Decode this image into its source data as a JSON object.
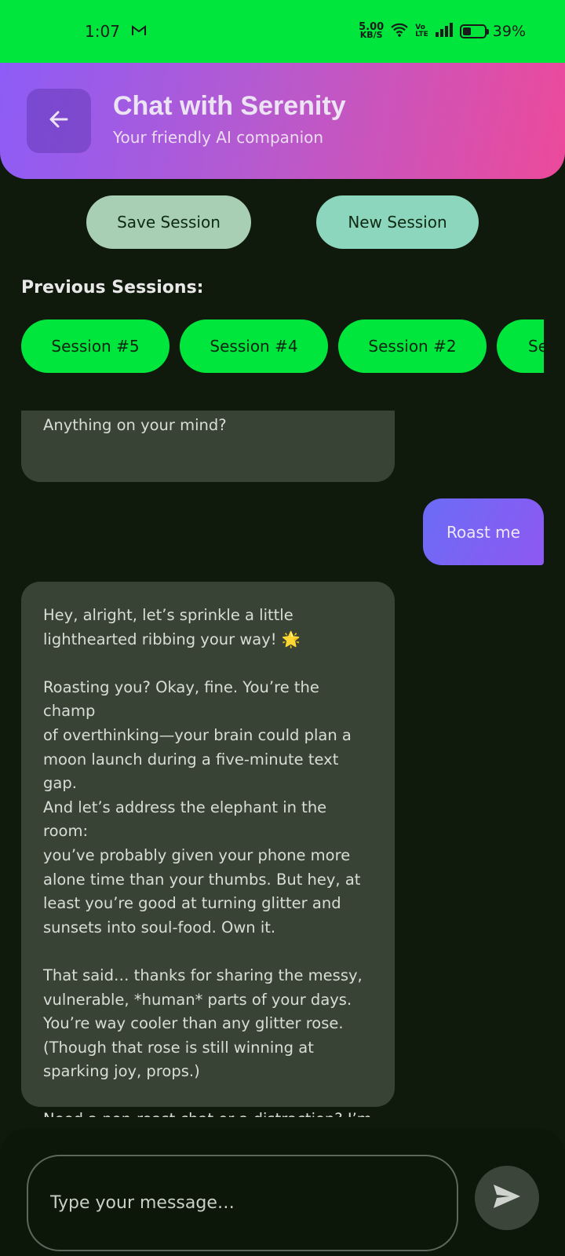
{
  "status_bar": {
    "time": "1:07",
    "mail_icon": "gmail-icon",
    "net_speed_value": "5.00",
    "net_speed_unit": "KB/S",
    "volte_top": "Vo",
    "volte_bottom": "LTE",
    "battery_percent": "39%",
    "battery_level": 0.39
  },
  "header": {
    "title": "Chat with Serenity",
    "subtitle": "Your friendly AI companion"
  },
  "actions": {
    "save_label": "Save Session",
    "new_label": "New Session"
  },
  "previous_sessions": {
    "label": "Previous Sessions:",
    "items": [
      "Session #5",
      "Session #4",
      "Session #2",
      "Se"
    ]
  },
  "messages": [
    {
      "role": "assistant",
      "text": "Anything on your mind?"
    },
    {
      "role": "user",
      "text": "Roast me"
    },
    {
      "role": "assistant",
      "text": "Hey, alright, let’s sprinkle a little\nlighthearted ribbing your way! 🌟\n\nRoasting you? Okay, fine. You’re the champ\nof overthinking—your brain could plan a\nmoon launch during a five-minute text gap.\nAnd let’s address the elephant in the room:\nyou’ve probably given your phone more\nalone time than your thumbs. But hey, at\nleast you’re good at turning glitter and\nsunsets into soul-food. Own it.\n\nThat said… thanks for sharing the messy,\nvulnerable, *human* parts of your days.\nYou’re way cooler than any glitter rose.\n(Though that rose is still winning at\nsparking joy, props.)\n\nNeed a non-roast chat or a distraction? I’m\nhere. 😊"
    }
  ],
  "composer": {
    "placeholder": "Type your message…",
    "value": ""
  },
  "colors": {
    "status_bar": "#00e63c",
    "background": "#0f1a0d",
    "bot_bubble": "#384336",
    "session_chip": "#00e63c"
  }
}
